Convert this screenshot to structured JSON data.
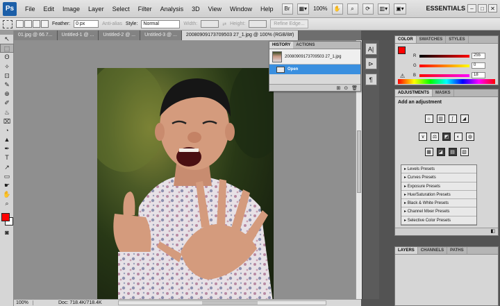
{
  "app": {
    "logo": "Ps"
  },
  "menu": [
    "File",
    "Edit",
    "Image",
    "Layer",
    "Select",
    "Filter",
    "Analysis",
    "3D",
    "View",
    "Window",
    "Help"
  ],
  "menubar_tools": {
    "zoom": "100%",
    "workspace": "ESSENTIALS",
    "window_controls": [
      "–",
      "□",
      "✕"
    ]
  },
  "options_bar": {
    "feather_label": "Feather:",
    "feather_value": "0 px",
    "antialias_label": "Anti-alias",
    "style_label": "Style:",
    "style_value": "Normal",
    "width_label": "Width:",
    "height_label": "Height:",
    "refine_label": "Refine Edge..."
  },
  "tabs": [
    {
      "label": "01.jpg @ 66.7..."
    },
    {
      "label": "Untitled-1 @ ..."
    },
    {
      "label": "Untitled-2 @ ..."
    },
    {
      "label": "Untitled-3 @ ..."
    },
    {
      "label": "20080909173709503 27_1.jpg @ 100% (RGB/8#)"
    }
  ],
  "tools": [
    "↖",
    "⬚",
    "ʘ",
    "✧",
    "⊡",
    "✎",
    "⊕",
    "✐",
    "♨",
    "⌧",
    "◔",
    "▲",
    "✒",
    "T",
    "↗",
    "▭",
    "☛",
    "✋",
    "⌕"
  ],
  "status": {
    "zoom": "100%",
    "doc": "Doc: 718.4K/718.4K"
  },
  "history": {
    "tabs": [
      "HISTORY",
      "ACTIONS"
    ],
    "snapshot_label": "20080909173709503 27_1.jpg",
    "rows": [
      {
        "label": "Open"
      }
    ],
    "footer_icons": [
      "⊞",
      "⊙",
      "🗑"
    ]
  },
  "icon_strip": [
    "A|",
    "⊳",
    "¶"
  ],
  "color_panel": {
    "tabs": [
      "COLOR",
      "SWATCHES",
      "STYLES"
    ],
    "channels": [
      {
        "name": "R",
        "value": "255",
        "gradient": "linear-gradient(90deg,#000,#f00)"
      },
      {
        "name": "G",
        "value": "0",
        "gradient": "linear-gradient(90deg,#f00,#ff0)"
      },
      {
        "name": "B",
        "value": "18",
        "gradient": "linear-gradient(90deg,#f00,#f0f)"
      }
    ],
    "fg": "#ff0000",
    "bg": "#ffffff"
  },
  "adjustments": {
    "tabs": [
      "ADJUSTMENTS",
      "MASKS"
    ],
    "title": "Add an adjustment",
    "row1": [
      "☼",
      "▥",
      "∫",
      "◢"
    ],
    "row2": [
      "∨",
      "⚖",
      "◩",
      "◐",
      "◍"
    ],
    "row3": [
      "▦",
      "◪",
      "▤",
      "▧"
    ],
    "presets": [
      "Levels Presets",
      "Curves Presets",
      "Exposure Presets",
      "Hue/Saturation Presets",
      "Black & White Presets",
      "Channel Mixer Presets",
      "Selective Color Presets"
    ]
  },
  "layers_panel": {
    "tabs": [
      "LAYERS",
      "CHANNELS",
      "PATHS"
    ]
  }
}
